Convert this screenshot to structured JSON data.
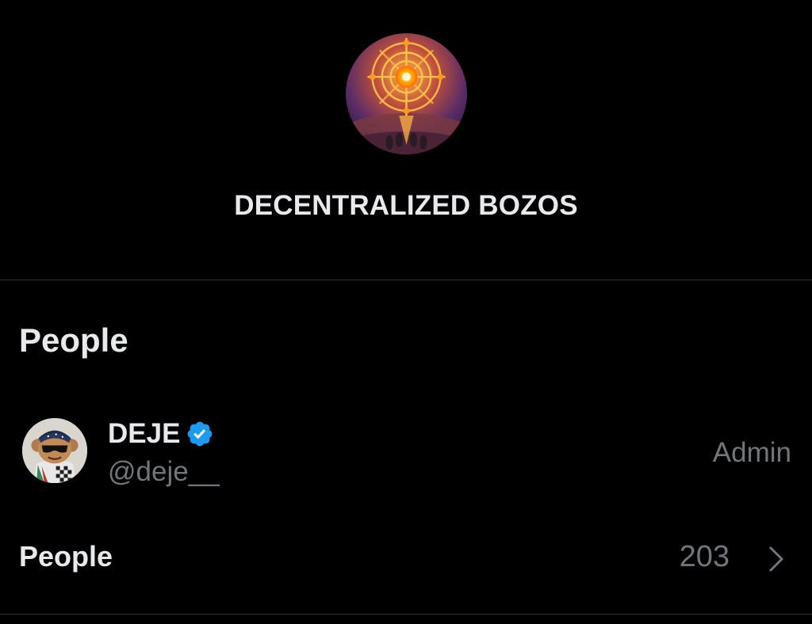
{
  "group": {
    "name": "DECENTRALIZED BOZOS",
    "avatar_icon": "group-avatar-icon"
  },
  "people_section": {
    "heading": "People",
    "members": [
      {
        "name": "DEJE",
        "handle": "@deje__",
        "role": "Admin",
        "verified": true,
        "avatar_icon": "member-avatar-icon"
      }
    ],
    "all_people": {
      "label": "People",
      "count": "203"
    }
  },
  "colors": {
    "background": "#000000",
    "text_primary": "#e7e9ea",
    "text_secondary": "#71767b",
    "divider": "#2f3336",
    "verified_blue": "#1d9bf0"
  }
}
